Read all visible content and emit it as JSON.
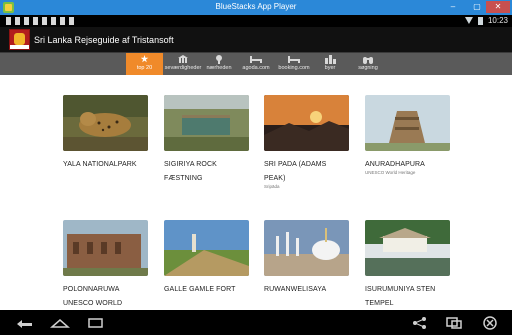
{
  "window": {
    "title": "BlueStacks App Player",
    "buttons": {
      "minimize": "–",
      "maximize": "▢",
      "close": "✕"
    }
  },
  "status_bar": {
    "time": "10:23"
  },
  "app": {
    "title": "Sri Lanka Rejseguide af Tristansoft"
  },
  "tabs": [
    {
      "label": "top 20",
      "icon": "star-icon",
      "active": true
    },
    {
      "label": "seværdigheder",
      "icon": "landmark-icon",
      "active": false
    },
    {
      "label": "nærheden",
      "icon": "radar-icon",
      "active": false
    },
    {
      "label": "agoda.com",
      "icon": "bed-icon",
      "active": false
    },
    {
      "label": "booking.com",
      "icon": "bed-icon",
      "active": false
    },
    {
      "label": "byer",
      "icon": "city-icon",
      "active": false
    },
    {
      "label": "søgning",
      "icon": "binoculars-icon",
      "active": false
    }
  ],
  "attractions": [
    {
      "name": "YALA NATIONALPARK",
      "subtitle": ""
    },
    {
      "name": "SIGIRIYA ROCK FÆSTNING",
      "subtitle": ""
    },
    {
      "name": "SRI PADA (ADAMS PEAK)",
      "subtitle": "Sripāda"
    },
    {
      "name": "ANURADHAPURA",
      "subtitle": "UNESCO World Heritage"
    },
    {
      "name": "POLONNARUWA UNESCO WORLD",
      "subtitle": ""
    },
    {
      "name": "GALLE GAMLE FORT",
      "subtitle": ""
    },
    {
      "name": "RUWANWELISAYA",
      "subtitle": ""
    },
    {
      "name": "ISURUMUNIYA STEN TEMPEL",
      "subtitle": ""
    }
  ],
  "nav": {
    "back": "back-icon",
    "home": "home-icon",
    "recents": "recents-icon",
    "share": "share-icon",
    "screen": "screen-icon",
    "close": "close-icon"
  },
  "colors": {
    "accent": "#f08a2a",
    "titlebar": "#2b88d8",
    "tabbar": "#5a5a5a"
  }
}
